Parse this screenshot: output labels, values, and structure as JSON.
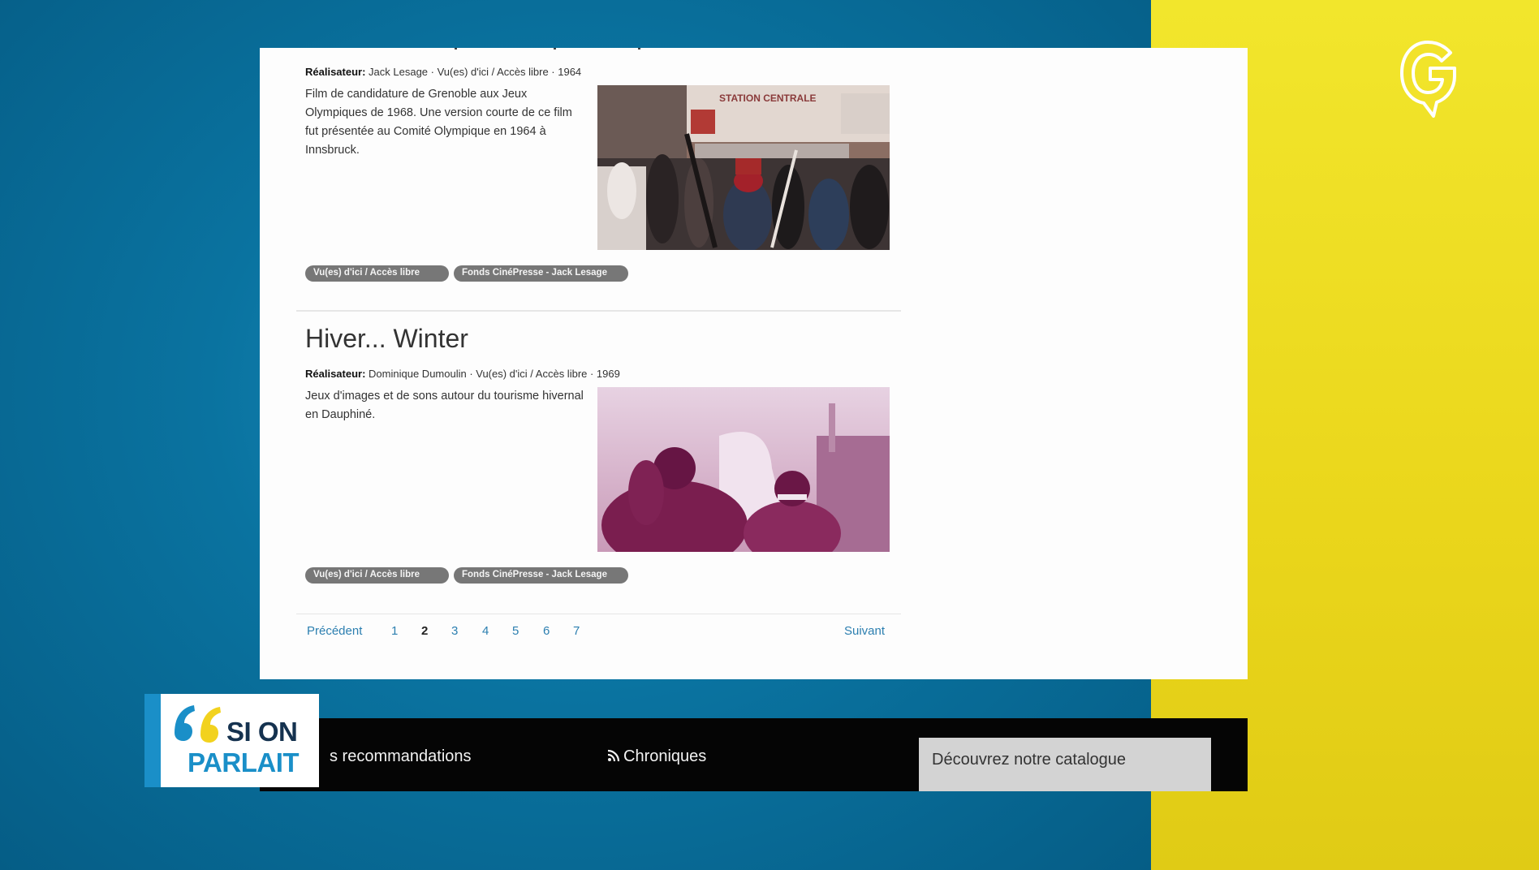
{
  "page": {
    "item1": {
      "meta_label": "Réalisateur:",
      "meta_text": "Jack Lesage · Vu(es) d'ici / Accès libre · 1964",
      "description": "Film de candidature de Grenoble aux Jeux Olympiques de 1968. Une version courte de ce film fut présentée au Comité Olympique en 1964 à Innsbruck.",
      "photo_sign": "STATION CENTRALE",
      "tags": [
        "Vu(es) d'ici / Accès libre",
        "Fonds CinéPresse - Jack Lesage"
      ]
    },
    "item2": {
      "title": "Hiver... Winter",
      "meta_label": "Réalisateur:",
      "meta_text": "Dominique Dumoulin · Vu(es) d'ici / Accès libre · 1969",
      "description": "Jeux d'images et de sons autour du tourisme hivernal en Dauphiné.",
      "tags": [
        "Vu(es) d'ici / Accès libre",
        "Fonds CinéPresse - Jack Lesage"
      ]
    },
    "pagination": {
      "previous": "Précédent",
      "pages": [
        "1",
        "2",
        "3",
        "4",
        "5",
        "6",
        "7"
      ],
      "current": "2",
      "next": "Suivant"
    }
  },
  "footer": {
    "recommendations": "s recommandations",
    "chronicles": "Chroniques",
    "catalogue_button": "Découvrez notre catalogue"
  },
  "show_logo": {
    "line1": "SI ON",
    "line2": "PARLAIT"
  },
  "channel_logo": {
    "letter": "G",
    "color": "#f0e21c"
  },
  "colors": {
    "background_blue": "#0a73a0",
    "background_yellow": "#ead61b",
    "link": "#2c7fb0",
    "tag": "#777777"
  }
}
